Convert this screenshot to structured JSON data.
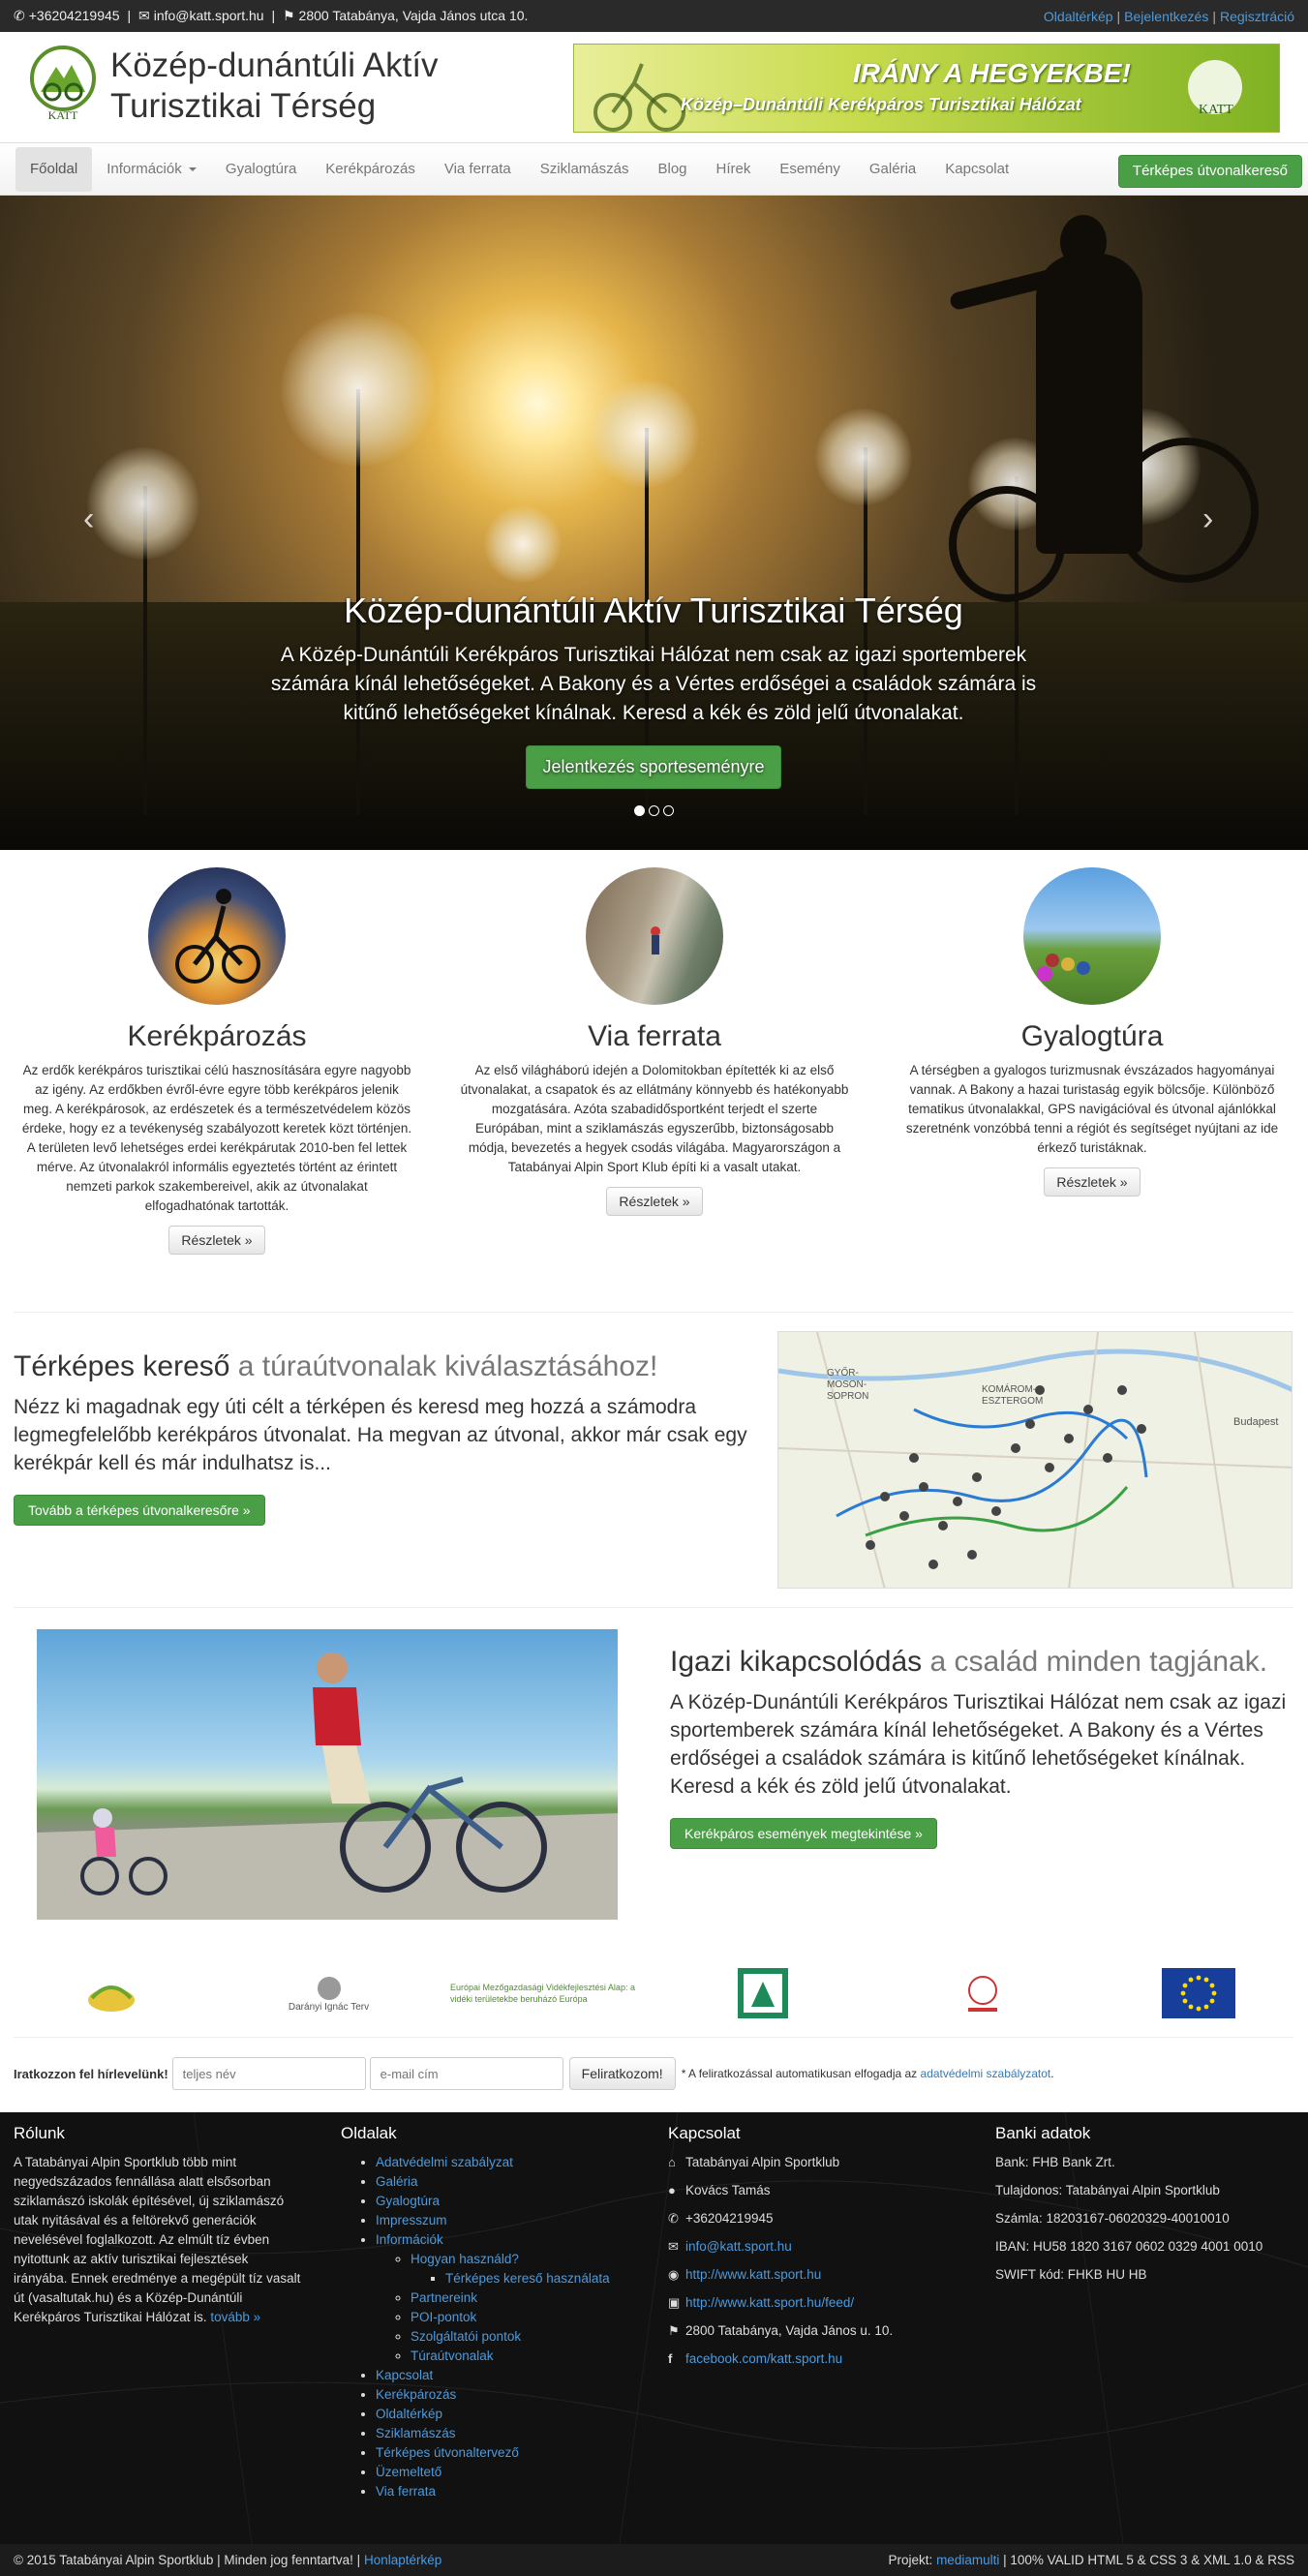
{
  "topbar": {
    "phone": "+36204219945",
    "email": "info@katt.sport.hu",
    "address": "2800 Tatabánya, Vajda János utca 10.",
    "links": [
      "Oldaltérkép",
      "Bejelentkezés",
      "Regisztráció"
    ]
  },
  "header": {
    "logo_text": "KATT",
    "title": "Közép-dunántúli Aktív Turisztikai Térség",
    "banner_line1": "IRÁNY A HEGYEKBE!",
    "banner_line2": "Közép–Dunántúli Kerékpáros Turisztikai Hálózat",
    "banner_logo": "KATT"
  },
  "nav": {
    "items": [
      "Főoldal",
      "Információk",
      "Gyalogtúra",
      "Kerékpározás",
      "Via ferrata",
      "Sziklamászás",
      "Blog",
      "Hírek",
      "Esemény",
      "Galéria",
      "Kapcsolat"
    ],
    "active": "Főoldal",
    "cta": "Térképes útvonalkereső"
  },
  "hero": {
    "title": "Közép-dunántúli Aktív Turisztikai Térség",
    "text": "A Közép-Dunántúli Kerékpáros Turisztikai Hálózat nem csak az igazi sportemberek számára kínál lehetőségeket. A Bakony és a Vértes erdőségei a családok számára is kitűnő lehetőségeket kínálnak. Keresd a kék és zöld jelű útvonalakat.",
    "button": "Jelentkezés sporteseményre",
    "prev": "‹",
    "next": "›",
    "slides": 3,
    "active_slide": 1
  },
  "features": [
    {
      "title": "Kerékpározás",
      "text": "Az erdők kerékpáros turisztikai célú hasznosítására egyre nagyobb az igény. Az erdőkben évről-évre egyre több kerékpáros jelenik meg. A kerékpárosok, az erdészetek és a természetvédelem közös érdeke, hogy ez a tevékenység szabályozott keretek közt történjen. A területen levő lehetséges erdei kerékpárutak 2010-ben fel lettek mérve. Az útvonalakról informális egyeztetés történt az érintett nemzeti parkok szakembereivel, akik az útvonalakat elfogadhatónak tartották.",
      "button": "Részletek »"
    },
    {
      "title": "Via ferrata",
      "text": "Az első világháború idején a Dolomitokban építették ki az első útvonalakat, a csapatok és az ellátmány könnyebb és hatékonyabb mozgatására. Azóta szabadidősportként terjedt el szerte Európában, mint a sziklamászás egyszerűbb, biztonságosabb módja, bevezetés a hegyek csodás világába. Magyarországon a Tatabányai Alpin Sport Klub építi ki a vasalt utakat.",
      "button": "Részletek »"
    },
    {
      "title": "Gyalogtúra",
      "text": "A térségben a gyalogos turizmusnak évszázados hagyományai vannak. A Bakony a hazai turistaság egyik bölcsője. Különböző tematikus útvonalakkal, GPS navigációval és útvonal ajánlókkal szeretnénk vonzóbbá tenni a régiót és segítséget nyújtani az ide érkező turistáknak.",
      "button": "Részletek »"
    }
  ],
  "map_section": {
    "title_strong": "Térképes kereső",
    "title_muted": "a túraútvonalak kiválasztásához!",
    "text": "Nézz ki magadnak egy úti célt a térképen és keresd meg hozzá a számodra legmegfelelőbb kerékpáros útvonalat. Ha megvan az útvonal, akkor már csak egy kerékpár kell és már indulhatsz is...",
    "button": "Tovább a térképes útvonalkeresőre »",
    "map_labels": [
      "GYŐR-",
      "MOSON-",
      "SOPRON",
      "KOMÁROM-",
      "ESZTERGOM",
      "Budapest"
    ]
  },
  "family_section": {
    "title_strong": "Igazi kikapcsolódás",
    "title_muted": "a család minden tagjának.",
    "text": "A Közép-Dunántúli Kerékpáros Turisztikai Hálózat nem csak az igazi sportemberek számára kínál lehetőségeket. A Bakony és a Vértes erdőségei a családok számára is kitűnő lehetőségeket kínálnak. Keresd a kék és zöld jelű útvonalakat.",
    "button": "Kerékpáros események megtekintése »"
  },
  "sponsors": [
    "Darányi Ignác Terv",
    "Európai Mezőgazdasági Vidékfejlesztési Alap: a vidéki területekbe beruházó Európa"
  ],
  "newsletter": {
    "label": "Iratkozzon fel hírlevelünk!",
    "name_placeholder": "teljes név",
    "email_placeholder": "e-mail cím",
    "button": "Feliratkozom!",
    "note_prefix": "* A feliratkozással automatikusan elfogadja az",
    "note_link": "adatvédelmi szabályzatot",
    "note_suffix": "."
  },
  "footer": {
    "about": {
      "title": "Rólunk",
      "text": "A Tatabányai Alpin Sportklub több mint negyedszázados fennállása alatt elsősorban sziklamászó iskolák építésével, új sziklamászó utak nyitásával és a feltörekvő generációk nevelésével foglalkozott. Az elmúlt tíz évben nyitottunk az aktív turisztikai fejlesztések irányába. Ennek eredménye a megépült tíz vasalt út (vasaltutak.hu) és a Közép-Dunántúli Kerékpáros Turisztikai Hálózat is.",
      "more": "tovább »"
    },
    "pages": {
      "title": "Oldalak",
      "items": [
        "Adatvédelmi szabályzat",
        "Galéria",
        "Gyalogtúra",
        "Impresszum"
      ],
      "info": "Információk",
      "howto": "Hogyan használd?",
      "howto_sub": "Térképes kereső használata",
      "info_items": [
        "Partnereink",
        "POI-pontok",
        "Szolgáltatói pontok",
        "Túraútvonalak"
      ],
      "items2": [
        "Kapcsolat",
        "Kerékpározás",
        "Oldaltérkép",
        "Sziklamászás",
        "Térképes útvonaltervező",
        "Üzemeltető",
        "Via ferrata"
      ]
    },
    "contact": {
      "title": "Kapcsolat",
      "rows": [
        {
          "icon": "home-icon",
          "text": "Tatabányai Alpin Sportklub",
          "link": false
        },
        {
          "icon": "user-icon",
          "text": "Kovács Tamás",
          "link": false
        },
        {
          "icon": "phone-icon",
          "text": "+36204219945",
          "link": false
        },
        {
          "icon": "envelope-icon",
          "text": "info@katt.sport.hu",
          "link": true
        },
        {
          "icon": "globe-icon",
          "text": "http://www.katt.sport.hu",
          "link": true
        },
        {
          "icon": "rss-icon",
          "text": "http://www.katt.sport.hu/feed/",
          "link": true
        },
        {
          "icon": "map-marker-icon",
          "text": "2800 Tatabánya, Vajda János u. 10.",
          "link": false
        },
        {
          "icon": "facebook-icon",
          "text": "facebook.com/katt.sport.hu",
          "link": true
        }
      ]
    },
    "bank": {
      "title": "Banki adatok",
      "rows": [
        "Bank: FHB Bank Zrt.",
        "Tulajdonos: Tatabányai Alpin Sportklub",
        "Számla: 18203167-06020329-40010010",
        "IBAN: HU58 1820 3167 0602 0329 4001 0010",
        "SWIFT kód: FHKB HU HB"
      ]
    }
  },
  "bottom": {
    "copyright": "© 2015 Tatabányai Alpin Sportklub | Minden jog fenntartva! |",
    "sitemap": "Honlaptérkép",
    "project_prefix": "Projekt:",
    "project_link": "mediamulti",
    "project_suffix": "| 100% VALID HTML 5 & CSS 3 & XML 1.0 & RSS"
  },
  "colors": {
    "accent_green": "#4a9e45",
    "link_blue": "#337ab7",
    "topbar": "#2a2a2a",
    "footer": "#111111"
  }
}
